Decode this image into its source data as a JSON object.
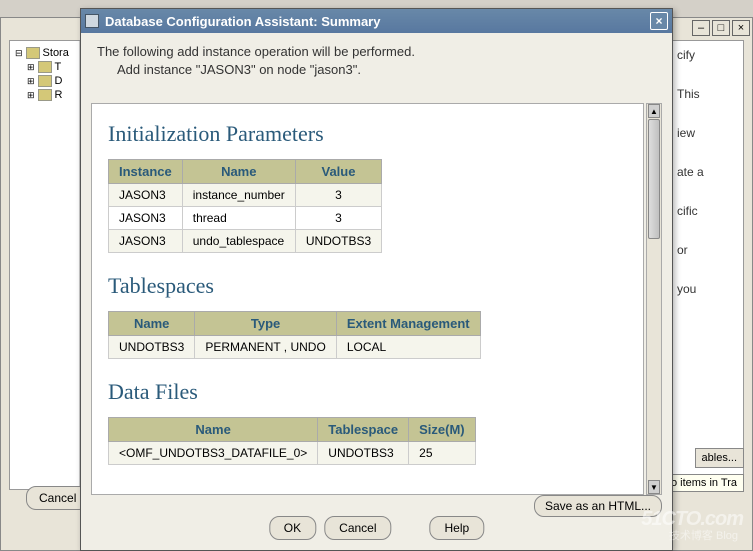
{
  "bg": {
    "tree_root": "Stora",
    "children": [
      "T",
      "D",
      "R"
    ],
    "right_snippets": [
      "cify",
      "This",
      "iew",
      "ate a",
      "cific",
      "or",
      "you"
    ],
    "cancel": "Cancel",
    "ables": "ables...",
    "no_items": "No items in Tra"
  },
  "dialog": {
    "title": "Database Configuration Assistant: Summary",
    "intro_line1": "The following add instance operation will be performed.",
    "intro_line2": "Add instance \"JASON3\" on node \"jason3\".",
    "save_btn": "Save as an HTML...",
    "ok": "OK",
    "cancel": "Cancel",
    "help": "Help"
  },
  "sections": {
    "init_params": {
      "title": "Initialization Parameters",
      "headers": [
        "Instance",
        "Name",
        "Value"
      ],
      "rows": [
        [
          "JASON3",
          "instance_number",
          "3"
        ],
        [
          "JASON3",
          "thread",
          "3"
        ],
        [
          "JASON3",
          "undo_tablespace",
          "UNDOTBS3"
        ]
      ]
    },
    "tablespaces": {
      "title": "Tablespaces",
      "headers": [
        "Name",
        "Type",
        "Extent Management"
      ],
      "rows": [
        [
          "UNDOTBS3",
          "PERMANENT , UNDO",
          "LOCAL"
        ]
      ]
    },
    "datafiles": {
      "title": "Data Files",
      "headers": [
        "Name",
        "Tablespace",
        "Size(M)"
      ],
      "rows": [
        [
          "<OMF_UNDOTBS3_DATAFILE_0>",
          "UNDOTBS3",
          "25"
        ]
      ]
    }
  },
  "watermark": {
    "main": "51CTO.com",
    "sub": "技术博客   Blog"
  }
}
